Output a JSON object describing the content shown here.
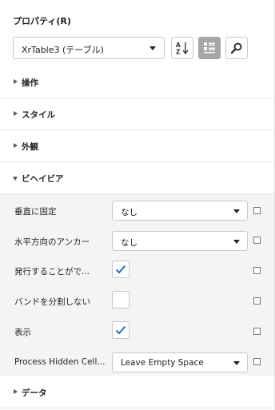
{
  "header": {
    "title": "プロパティ(R)"
  },
  "toolbar": {
    "component_selector_value": "XrTable3 (テーブル)",
    "sort_button_icon": "sort-alphabetical-icon",
    "categories_button_icon": "categories-icon",
    "search_button_icon": "search-icon"
  },
  "sections": [
    {
      "label": "操作",
      "expanded": false
    },
    {
      "label": "スタイル",
      "expanded": false
    },
    {
      "label": "外観",
      "expanded": false
    },
    {
      "label": "ビヘイビア",
      "expanded": true
    },
    {
      "label": "データ",
      "expanded": false
    }
  ],
  "behavior_properties": [
    {
      "label": "垂直に固定",
      "type": "select",
      "value": "なし"
    },
    {
      "label": "水平方向のアンカー",
      "type": "select",
      "value": "なし"
    },
    {
      "label": "発行することがで...",
      "type": "checkbox",
      "checked": true
    },
    {
      "label": "バンドを分割しない",
      "type": "checkbox",
      "checked": false
    },
    {
      "label": "表示",
      "type": "checkbox",
      "checked": true
    },
    {
      "label": "Process Hidden Cell...",
      "type": "select",
      "value": "Leave Empty Space"
    }
  ],
  "colors": {
    "check_accent": "#2f6fb0",
    "active_button": "#a6a6a6",
    "property_grid_bg": "#f4f4f4"
  }
}
